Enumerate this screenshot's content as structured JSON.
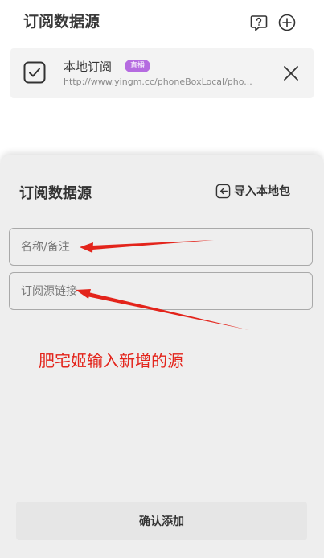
{
  "header": {
    "title": "订阅数据源",
    "help_icon": "question-bubble-icon",
    "add_icon": "plus-circle-icon"
  },
  "subscriptions": [
    {
      "name": "本地订阅",
      "badge": "直播",
      "url": "http://www.yingm.cc/phoneBoxLocal/pho...",
      "checked": true
    }
  ],
  "sheet": {
    "title": "订阅数据源",
    "import_label": "导入本地包",
    "name_field": {
      "placeholder": "名称/备注",
      "value": ""
    },
    "url_field": {
      "placeholder": "订阅源链接",
      "value": ""
    },
    "annotation": "肥宅姬输入新增的源",
    "confirm_label": "确认添加"
  },
  "colors": {
    "badge": "#b56be0",
    "annotation": "#e3241b",
    "sheet_bg": "#eeeeee"
  }
}
